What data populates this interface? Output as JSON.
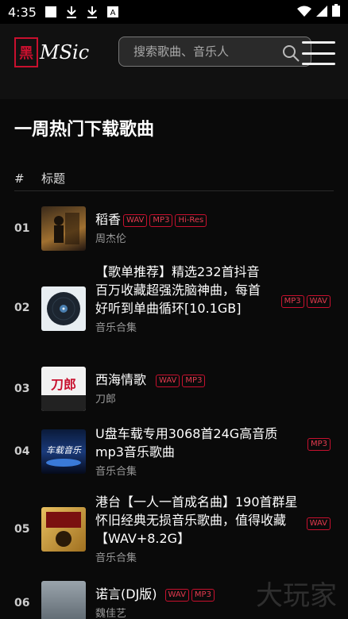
{
  "status_bar": {
    "time": "4:35",
    "icons": [
      "square-icon",
      "download-icon",
      "download-icon",
      "a-icon"
    ],
    "right_icons": [
      "wifi-icon",
      "signal-icon",
      "battery-icon"
    ]
  },
  "header": {
    "logo_seal": "黑",
    "logo_text": "MSic",
    "search_placeholder": "搜索歌曲、音乐人"
  },
  "main": {
    "page_title": "一周热门下载歌曲",
    "columns": [
      "#",
      "标题"
    ],
    "rows": [
      {
        "num": "01",
        "title": "稻香",
        "artist": "周杰伦",
        "tags": [
          "WAV",
          "MP3",
          "Hi-Res"
        ]
      },
      {
        "num": "02",
        "title": "【歌单推荐】精选232首抖音百万收藏超强洗脑神曲，每首好听到单曲循环[10.1GB]",
        "artist": "音乐合集",
        "tags": [
          "MP3",
          "WAV"
        ]
      },
      {
        "num": "03",
        "title": "西海情歌",
        "artist": "刀郎",
        "tags": [
          "WAV",
          "MP3"
        ]
      },
      {
        "num": "04",
        "title": "U盘车载专用3068首24G高音质mp3音乐歌曲",
        "artist": "音乐合集",
        "tags": [
          "MP3"
        ]
      },
      {
        "num": "05",
        "title": "港台【一人一首成名曲】190首群星怀旧经典无损音乐歌曲，值得收藏【WAV+8.2G】",
        "artist": "音乐合集",
        "tags": [
          "WAV"
        ]
      },
      {
        "num": "06",
        "title": "诺言(DJ版)",
        "artist": "魏佳艺",
        "tags": [
          "WAV",
          "MP3"
        ]
      }
    ],
    "thumb_texts": {
      "row4": "车载音乐",
      "row3": "刀郎"
    }
  },
  "watermark": "大玩家",
  "colors": {
    "accent": "#c8102e",
    "background": "#000000"
  }
}
